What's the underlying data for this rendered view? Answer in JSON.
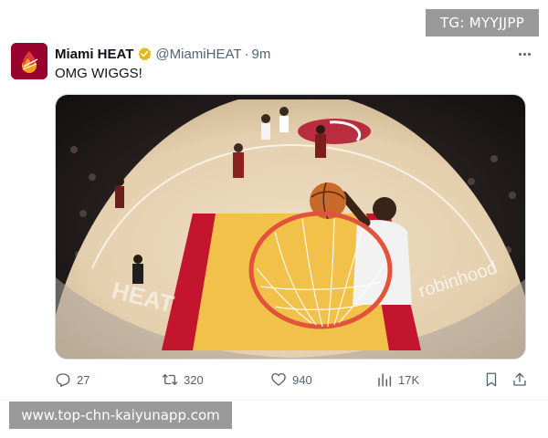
{
  "watermarks": {
    "top": "TG: MYYJJPP",
    "bottom": "www.top-chn-kaiyunapp.com"
  },
  "tweet": {
    "display_name": "Miami HEAT",
    "handle": "@MiamiHEAT",
    "separator": "·",
    "time": "9m",
    "text": "OMG WIGGS!",
    "media": {
      "court_text": "robinhood",
      "baseline_text": "HEAT"
    },
    "actions": {
      "replies": "27",
      "reposts": "320",
      "likes": "940",
      "views": "17K"
    }
  },
  "colors": {
    "heat_red": "#98002e",
    "heat_gold": "#f9a01b",
    "muted_text": "#536471",
    "verified_gold": "#e2b719"
  },
  "icons": {
    "reply": "reply-icon",
    "repost": "repost-icon",
    "like": "heart-icon",
    "views": "views-icon",
    "bookmark": "bookmark-icon",
    "share": "share-icon",
    "more": "more-icon",
    "verified": "verified-badge-icon"
  }
}
